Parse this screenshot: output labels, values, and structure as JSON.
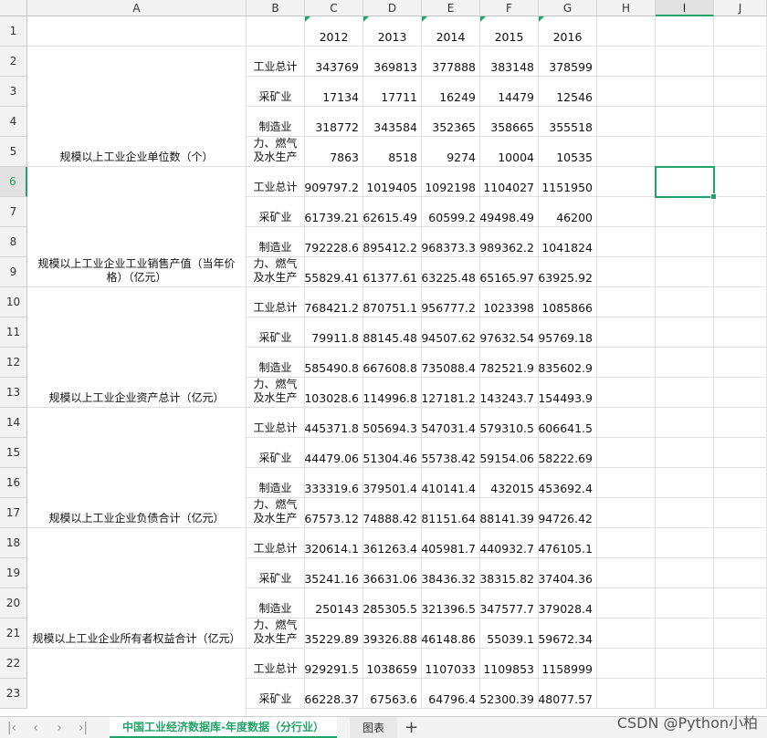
{
  "columns": [
    "A",
    "B",
    "C",
    "D",
    "E",
    "F",
    "G",
    "H",
    "I",
    "J"
  ],
  "selected_column": "I",
  "selected_row": 6,
  "years": [
    "2012",
    "2013",
    "2014",
    "2015",
    "2016"
  ],
  "groups": [
    {
      "label": "规模以上工业企业单位数（个）",
      "rows": [
        {
          "b": "工业总计",
          "v": [
            "343769",
            "369813",
            "377888",
            "383148",
            "378599"
          ]
        },
        {
          "b": "采矿业",
          "v": [
            "17134",
            "17711",
            "16249",
            "14479",
            "12546"
          ]
        },
        {
          "b": "制造业",
          "v": [
            "318772",
            "343584",
            "352365",
            "358665",
            "355518"
          ]
        },
        {
          "b": "力、燃气及水生产",
          "v": [
            "7863",
            "8518",
            "9274",
            "10004",
            "10535"
          ]
        }
      ]
    },
    {
      "label": "规模以上工业企业工业销售产值（当年价格）（亿元）",
      "rows": [
        {
          "b": "工业总计",
          "v": [
            "909797.2",
            "1019405",
            "1092198",
            "1104027",
            "1151950"
          ]
        },
        {
          "b": "采矿业",
          "v": [
            "61739.21",
            "62615.49",
            "60599.2",
            "49498.49",
            "46200"
          ]
        },
        {
          "b": "制造业",
          "v": [
            "792228.6",
            "895412.2",
            "968373.3",
            "989362.2",
            "1041824"
          ]
        },
        {
          "b": "力、燃气及水生产",
          "v": [
            "55829.41",
            "61377.61",
            "63225.48",
            "65165.97",
            "63925.92"
          ]
        }
      ]
    },
    {
      "label": "规模以上工业企业资产总计（亿元）",
      "rows": [
        {
          "b": "工业总计",
          "v": [
            "768421.2",
            "870751.1",
            "956777.2",
            "1023398",
            "1085866"
          ]
        },
        {
          "b": "采矿业",
          "v": [
            "79911.8",
            "88145.48",
            "94507.62",
            "97632.54",
            "95769.18"
          ]
        },
        {
          "b": "制造业",
          "v": [
            "585490.8",
            "667608.8",
            "735088.4",
            "782521.9",
            "835602.9"
          ]
        },
        {
          "b": "力、燃气及水生产",
          "v": [
            "103028.6",
            "114996.8",
            "127181.2",
            "143243.7",
            "154493.9"
          ]
        }
      ]
    },
    {
      "label": "规模以上工业企业负债合计（亿元）",
      "rows": [
        {
          "b": "工业总计",
          "v": [
            "445371.8",
            "505694.3",
            "547031.4",
            "579310.5",
            "606641.5"
          ]
        },
        {
          "b": "采矿业",
          "v": [
            "44479.06",
            "51304.46",
            "55738.42",
            "59154.06",
            "58222.69"
          ]
        },
        {
          "b": "制造业",
          "v": [
            "333319.6",
            "379501.4",
            "410141.4",
            "432015",
            "453692.4"
          ]
        },
        {
          "b": "力、燃气及水生产",
          "v": [
            "67573.12",
            "74888.42",
            "81151.64",
            "88141.39",
            "94726.42"
          ]
        }
      ]
    },
    {
      "label": "规模以上工业企业所有者权益合计（亿元）",
      "rows": [
        {
          "b": "工业总计",
          "v": [
            "320614.1",
            "361263.4",
            "405981.7",
            "440932.7",
            "476105.1"
          ]
        },
        {
          "b": "采矿业",
          "v": [
            "35241.16",
            "36631.06",
            "38436.32",
            "38315.82",
            "37404.36"
          ]
        },
        {
          "b": "制造业",
          "v": [
            "250143",
            "285305.5",
            "321396.5",
            "347577.7",
            "379028.4"
          ]
        },
        {
          "b": "力、燃气及水生产",
          "v": [
            "35229.89",
            "39326.88",
            "46148.86",
            "55039.1",
            "59672.34"
          ]
        }
      ]
    },
    {
      "label": "",
      "rows": [
        {
          "b": "工业总计",
          "v": [
            "929291.5",
            "1038659",
            "1107033",
            "1109853",
            "1158999"
          ]
        },
        {
          "b": "采矿业",
          "v": [
            "66228.37",
            "67563.6",
            "64796.4",
            "52300.39",
            "48077.57"
          ]
        }
      ]
    }
  ],
  "tabs": [
    {
      "label": "中国工业经济数据库-年度数据（分行业）",
      "active": true
    },
    {
      "label": "图表",
      "active": false
    }
  ],
  "tab_nav_icons": [
    "first-sheet-icon",
    "prev-sheet-icon",
    "next-sheet-icon",
    "last-sheet-icon"
  ],
  "add_sheet_symbol": "+",
  "watermark": "CSDN @Python小柏",
  "accent_color": "#21a366"
}
